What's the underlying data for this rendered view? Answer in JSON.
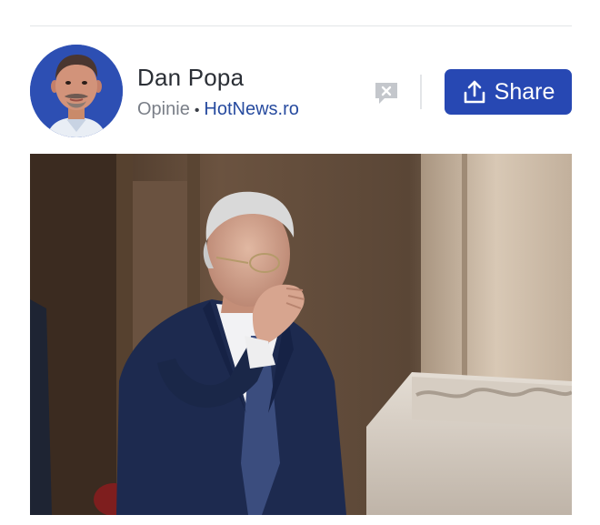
{
  "author": {
    "name": "Dan Popa",
    "section": "Opinie",
    "separator": "•",
    "source": "HotNews.ro"
  },
  "actions": {
    "comment_icon": "comment-closed-icon",
    "share_icon": "share-upload-icon",
    "share_label": "Share"
  },
  "colors": {
    "brand_blue": "#2748b3",
    "source_link": "#274b9f",
    "avatar_bg": "#2d4fb3",
    "divider": "#e3e5e8"
  }
}
